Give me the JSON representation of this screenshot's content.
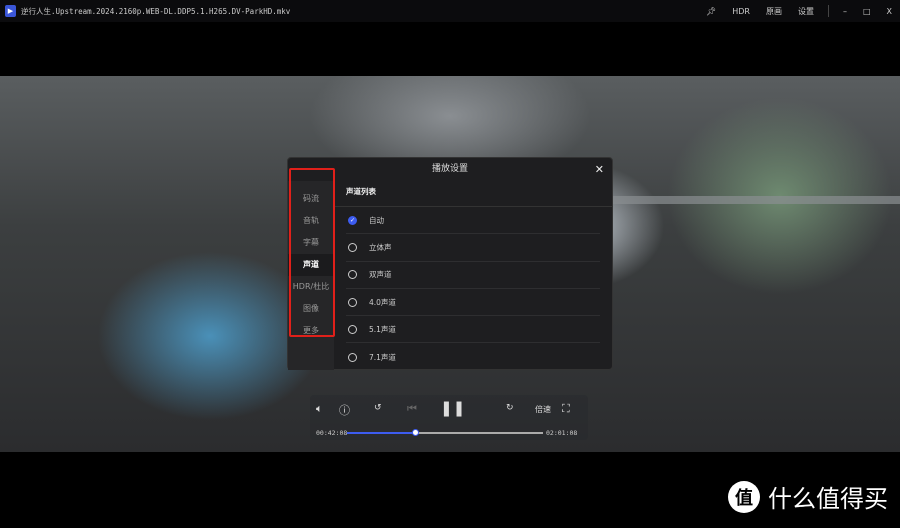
{
  "titlebar": {
    "app_icon": "play-icon",
    "title": "逆行人生.Upstream.2024.2160p.WEB-DL.DDP5.1.H265.DV-ParkHD.mkv",
    "pin_icon": "pin-icon",
    "hdr": "HDR",
    "picture": "原画",
    "settings": "设置",
    "minimize": "–",
    "maximize": "□",
    "close": "X"
  },
  "dialog": {
    "title": "播放设置",
    "close": "✕",
    "sidebar": [
      "码流",
      "音轨",
      "字幕",
      "声道",
      "HDR/杜比",
      "图像",
      "更多"
    ],
    "active_tab": "声道",
    "section_title": "声道列表",
    "options": [
      {
        "label": "自动",
        "selected": true
      },
      {
        "label": "立体声",
        "selected": false
      },
      {
        "label": "双声道",
        "selected": false
      },
      {
        "label": "4.0声道",
        "selected": false
      },
      {
        "label": "5.1声道",
        "selected": false
      },
      {
        "label": "7.1声道",
        "selected": false
      }
    ]
  },
  "controls": {
    "speed": "倍速",
    "current_time": "00:42:08",
    "total_time": "02:01:08",
    "progress": 0.35,
    "rewind": "10",
    "forward": "30"
  },
  "watermark": {
    "logo": "值",
    "text": "什么值得买"
  },
  "colors": {
    "accent": "#3d5cf0",
    "highlight": "#e0201a"
  }
}
